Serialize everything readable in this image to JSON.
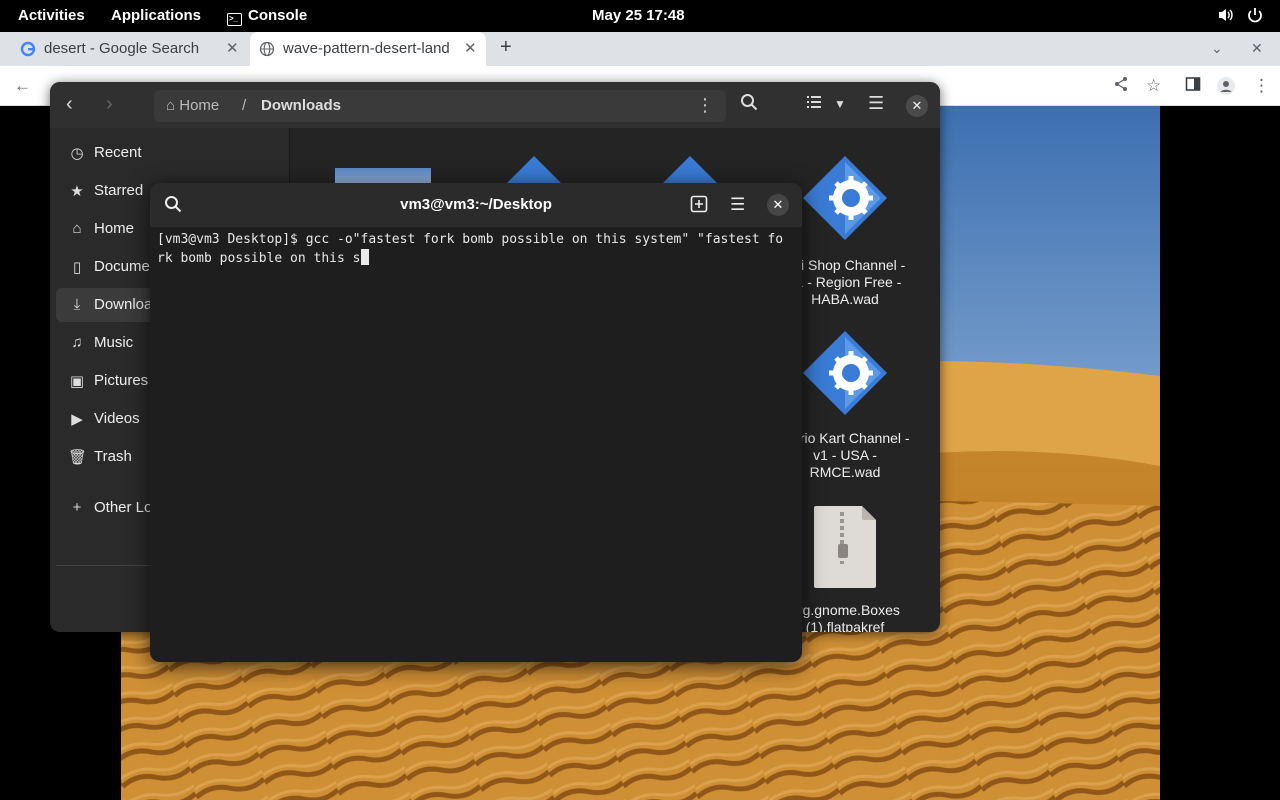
{
  "topbar": {
    "activities": "Activities",
    "applications": "Applications",
    "app_name": "Console",
    "clock": "May 25  17:48"
  },
  "chrome": {
    "tabs": [
      {
        "label": "desert - Google Search"
      },
      {
        "label": "wave-pattern-desert-land"
      }
    ]
  },
  "files": {
    "path": {
      "home": "Home",
      "separator": "/",
      "current": "Downloads"
    },
    "sidebar": [
      {
        "label": "Recent",
        "icon": "clock-icon"
      },
      {
        "label": "Starred",
        "icon": "star-icon"
      },
      {
        "label": "Home",
        "icon": "home-icon"
      },
      {
        "label": "Documents",
        "icon": "document-icon"
      },
      {
        "label": "Downloads",
        "icon": "download-icon"
      },
      {
        "label": "Music",
        "icon": "music-icon"
      },
      {
        "label": "Pictures",
        "icon": "picture-icon"
      },
      {
        "label": "Videos",
        "icon": "video-icon"
      },
      {
        "label": "Trash",
        "icon": "trash-icon"
      },
      {
        "label": "Other Locations",
        "icon": "plus-icon"
      }
    ],
    "items": [
      {
        "name": "Wii Shop Channel - v1 - Region Free - HABA.wad"
      },
      {
        "name": "Mario Kart Channel - v1 - USA - RMCE.wad"
      },
      {
        "name": "org.gnome.Boxes (1).flatpakref"
      }
    ]
  },
  "terminal": {
    "title": "vm3@vm3:~/Desktop",
    "line1": "[vm3@vm3 Desktop]$ gcc -o\"fastest fork bomb possible on this system\" \"fastest fo",
    "line2": "rk bomb possible on this s"
  }
}
